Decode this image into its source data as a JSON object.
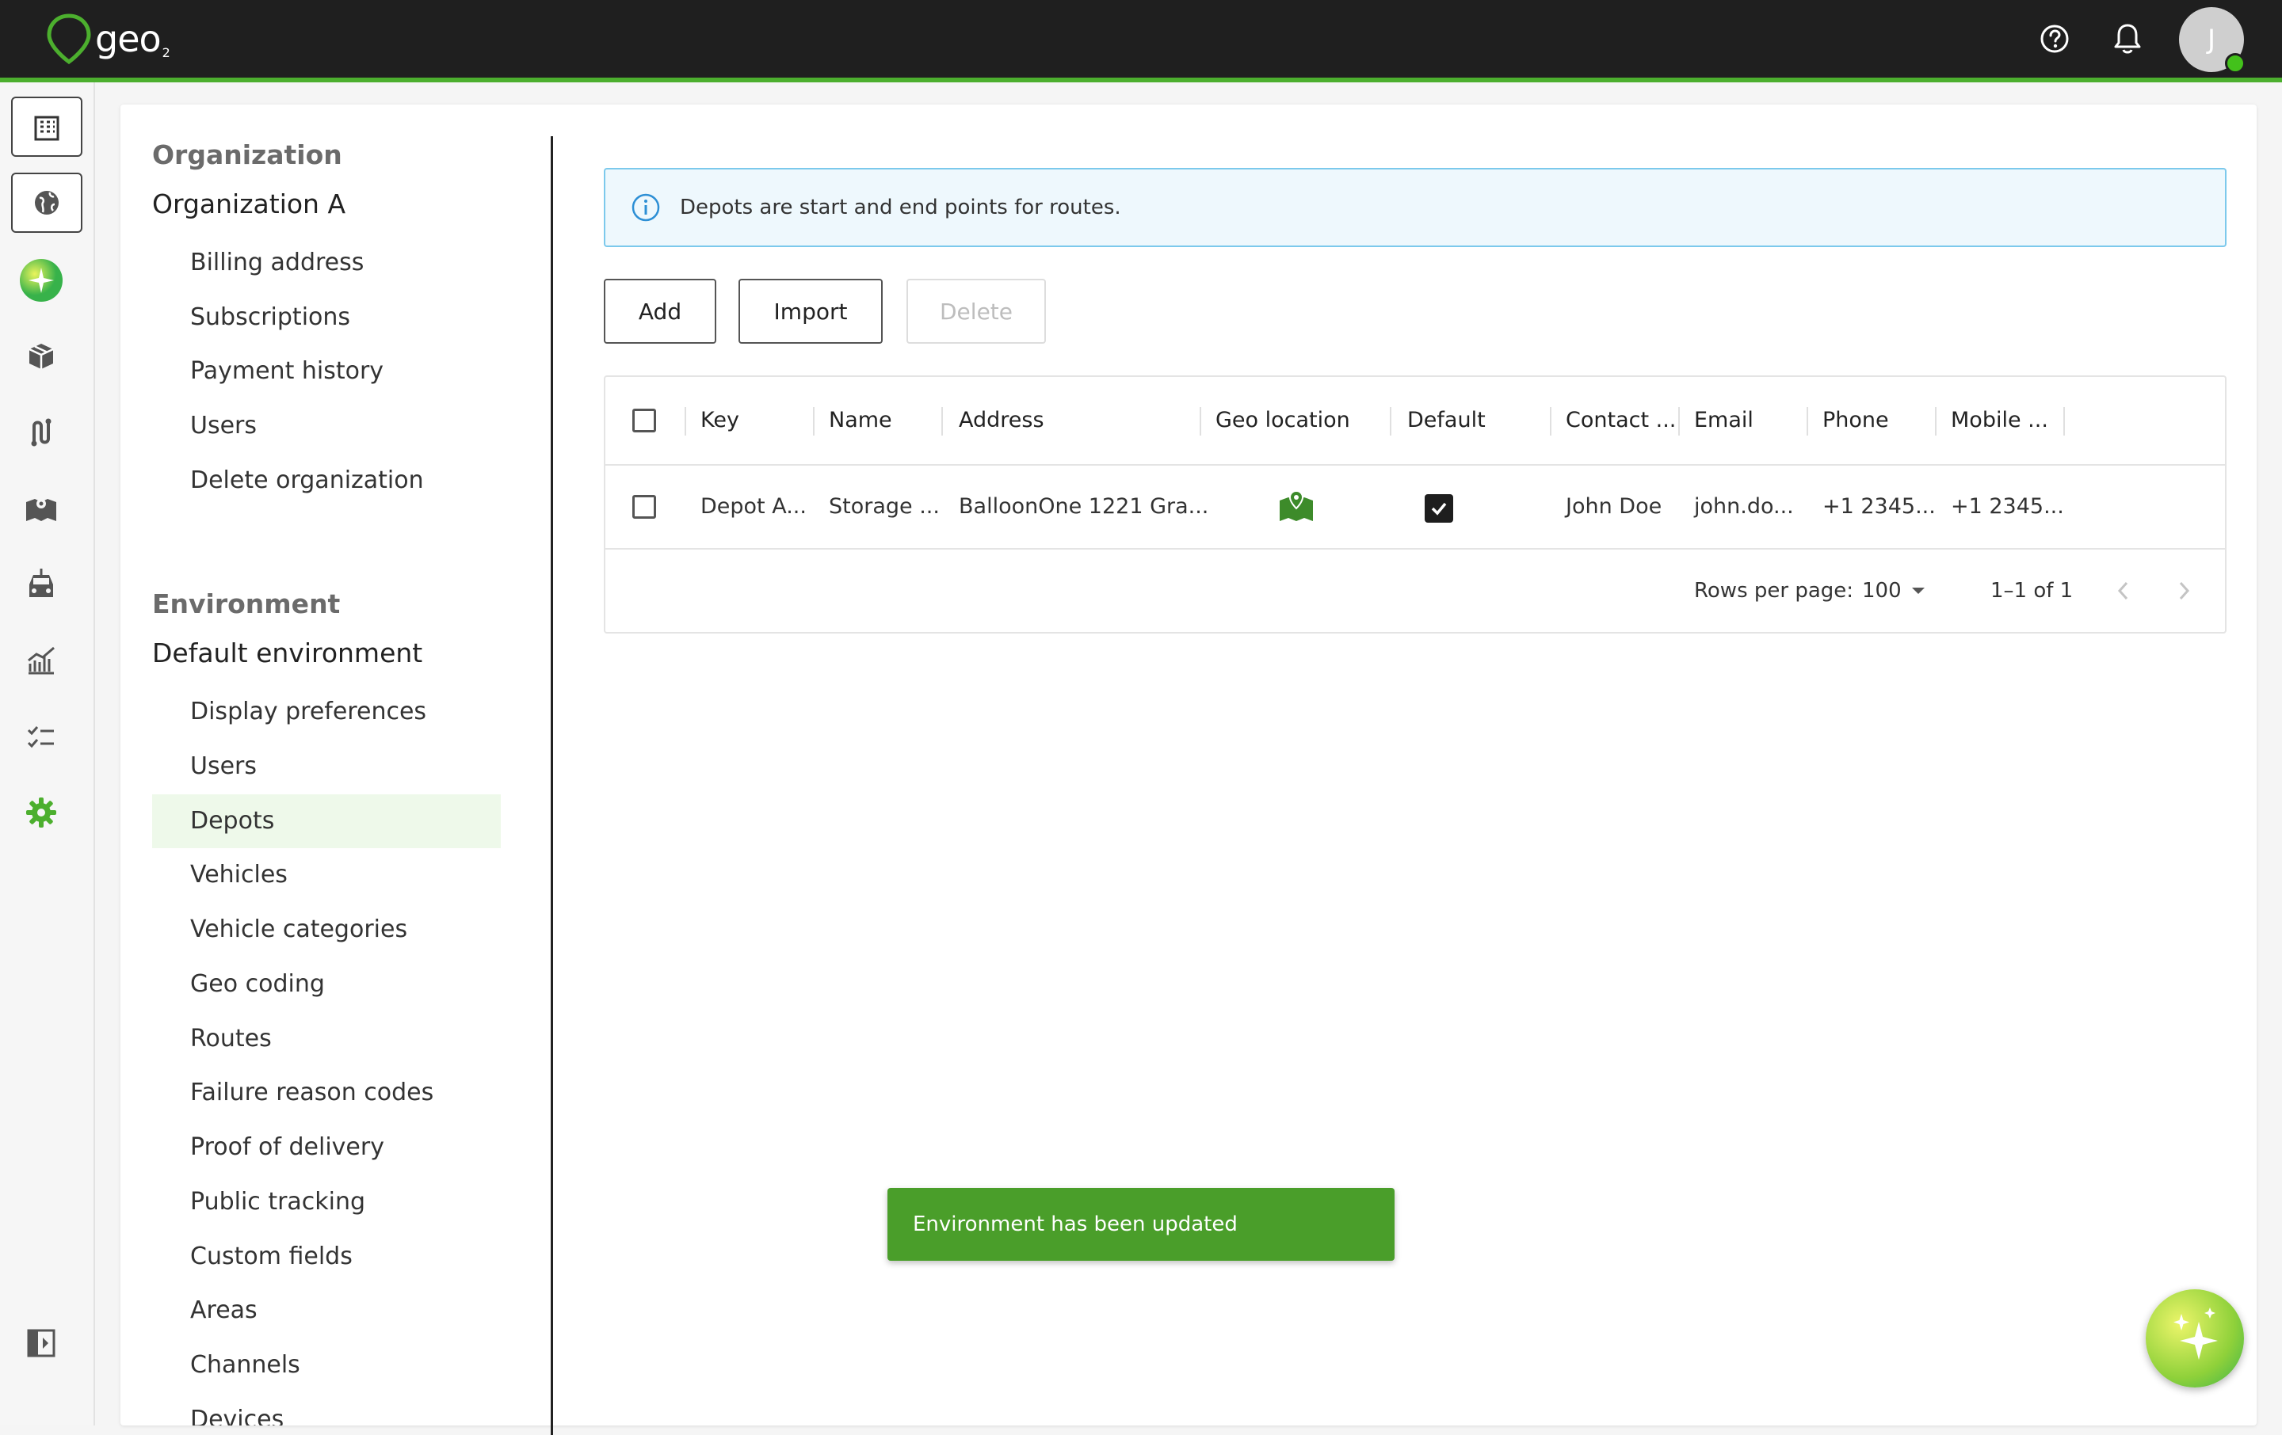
{
  "app": {
    "logo_text": "geo",
    "logo_sub": "2",
    "avatar_initial": "J"
  },
  "colors": {
    "brand": "#4caf2e",
    "topbar": "#1f1f1f",
    "toast": "#4a9e2a",
    "info_border": "#7cc9ec"
  },
  "topbar_icons": [
    "help-icon",
    "notification-bell-icon"
  ],
  "rail": {
    "items": [
      "organization-icon",
      "globe-icon",
      "ai-assistant-icon",
      "packages-icon",
      "routes-icon",
      "map-icon",
      "vehicle-icon",
      "analytics-icon",
      "checklist-icon",
      "settings-icon",
      "collapse-panel-icon"
    ]
  },
  "settings_nav": {
    "org_section": "Organization",
    "org_name": "Organization A",
    "org_items": [
      "Billing address",
      "Subscriptions",
      "Payment history",
      "Users",
      "Delete organization"
    ],
    "env_section": "Environment",
    "env_name": "Default environment",
    "env_items": [
      "Display preferences",
      "Users",
      "Depots",
      "Vehicles",
      "Vehicle categories",
      "Geo coding",
      "Routes",
      "Failure reason codes",
      "Proof of delivery",
      "Public tracking",
      "Custom fields",
      "Areas",
      "Channels",
      "Devices"
    ],
    "active_item": "Depots"
  },
  "info_banner": {
    "text": "Depots are start and end points for routes."
  },
  "actions": {
    "add": "Add",
    "import": "Import",
    "delete": "Delete"
  },
  "table": {
    "columns": [
      "Key",
      "Name",
      "Address",
      "Geo location",
      "Default",
      "Contact ...",
      "Email",
      "Phone",
      "Mobile ..."
    ],
    "rows": [
      {
        "key": "Depot A...",
        "name": "Storage ...",
        "address": "BalloonOne 1221 Gra...",
        "geo_location": "map-pin-icon",
        "default": true,
        "contact": "John Doe",
        "email": "john.do...",
        "phone": "+1 2345...",
        "mobile": "+1 2345..."
      }
    ],
    "footer": {
      "rows_per_page_label": "Rows per page:",
      "rows_per_page_value": "100",
      "range": "1–1 of 1"
    }
  },
  "toast": {
    "message": "Environment has been updated"
  }
}
